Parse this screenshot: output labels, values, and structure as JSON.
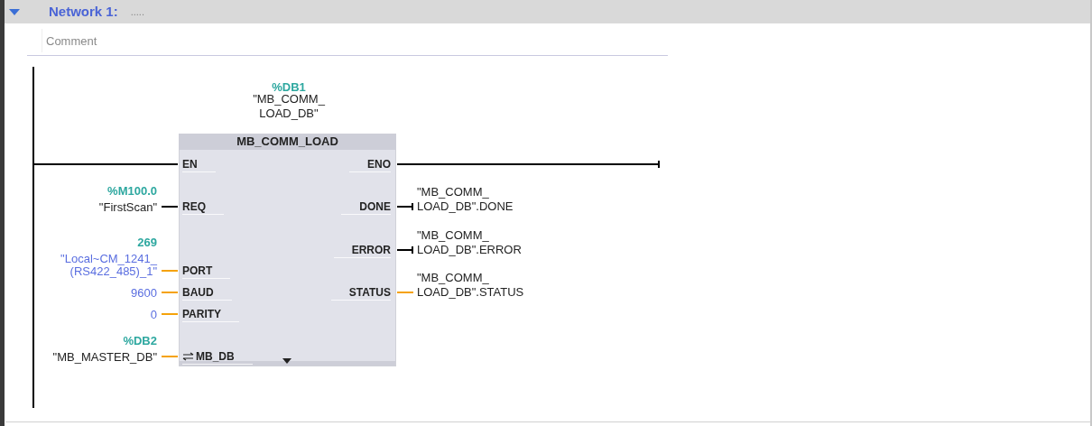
{
  "network": {
    "expanded": true,
    "title": "Network 1:",
    "name": ".....",
    "comment": {
      "placeholder": "Comment"
    }
  },
  "block": {
    "instance_address": "%DB1",
    "instance_name": [
      "\"MB_COMM_",
      "LOAD_DB\""
    ],
    "type": "MB_COMM_LOAD",
    "inputs": [
      {
        "pin": "EN",
        "kind": "power"
      },
      {
        "pin": "REQ",
        "kind": "bool",
        "address": "%M100.0",
        "operand": {
          "kind": "symbol",
          "lines": [
            "\"FirstScan\""
          ]
        }
      },
      {
        "pin": "PORT",
        "kind": "data",
        "address": "269",
        "operand": {
          "kind": "constant",
          "lines": [
            "\"Local~CM_1241_",
            "(RS422_485)_1\""
          ]
        }
      },
      {
        "pin": "BAUD",
        "kind": "data",
        "operand": {
          "kind": "constant",
          "lines": [
            "9600"
          ]
        }
      },
      {
        "pin": "PARITY",
        "kind": "data",
        "operand": {
          "kind": "constant",
          "lines": [
            "0"
          ]
        }
      },
      {
        "pin": "MB_DB",
        "kind": "inout",
        "address": "%DB2",
        "operand": {
          "kind": "symbol",
          "lines": [
            "\"MB_MASTER_DB\""
          ]
        }
      }
    ],
    "outputs": [
      {
        "pin": "ENO",
        "kind": "power"
      },
      {
        "pin": "DONE",
        "kind": "bool",
        "operand": [
          "\"MB_COMM_",
          "LOAD_DB\".DONE"
        ]
      },
      {
        "pin": "ERROR",
        "kind": "bool",
        "operand": [
          "\"MB_COMM_",
          "LOAD_DB\".ERROR"
        ]
      },
      {
        "pin": "STATUS",
        "kind": "data",
        "operand": [
          "\"MB_COMM_",
          "LOAD_DB\".STATUS"
        ]
      }
    ],
    "more_pins": true
  }
}
